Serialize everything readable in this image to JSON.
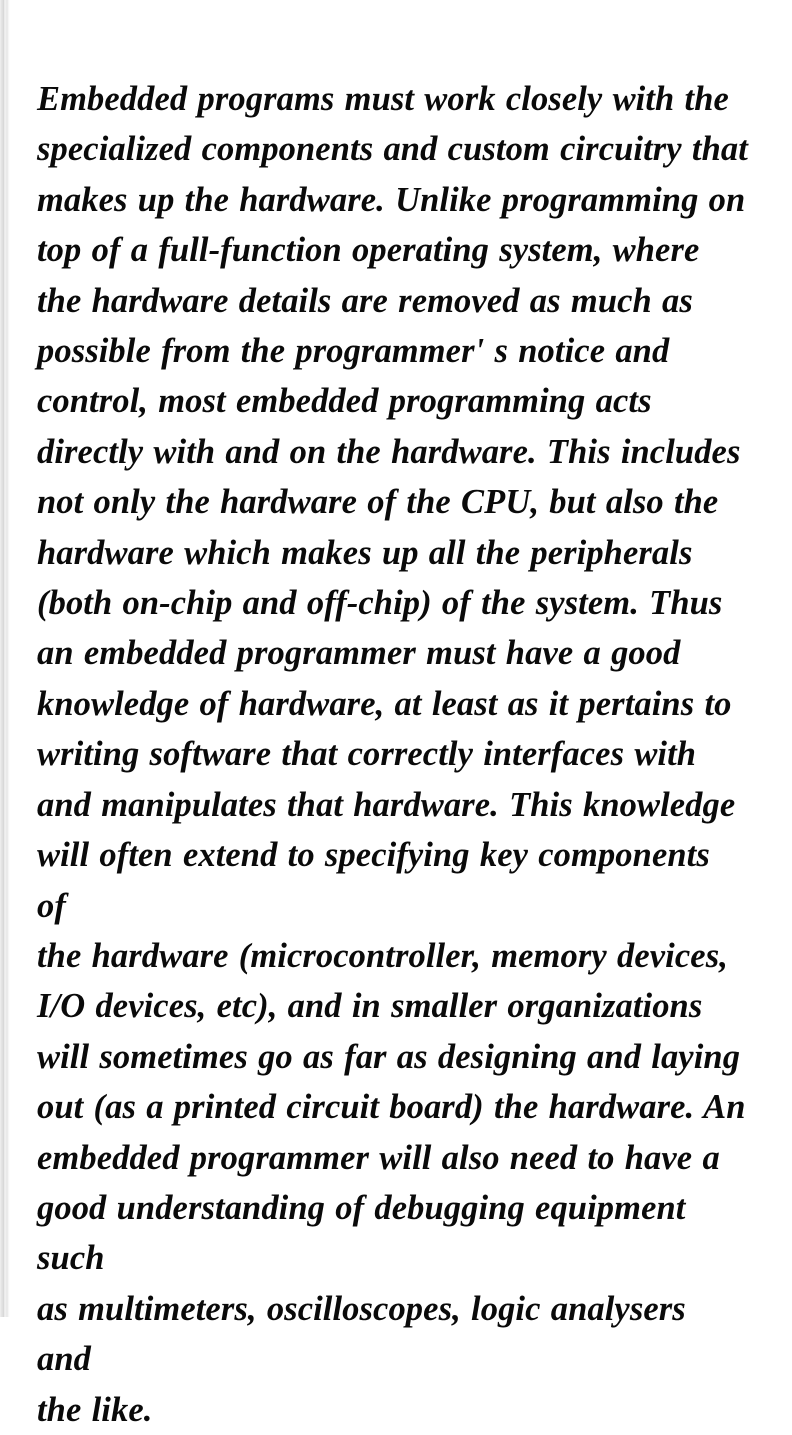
{
  "document": {
    "background_color": "#ffffff",
    "text_color": "#0a0a0a",
    "edge_shadow_color": "#d9d9d9",
    "paragraph": {
      "lines": [
        "Embedded programs must work closely with the",
        "specialized components and custom circuitry that",
        "makes up the hardware.  Unlike programming on",
        "top of a full-function operating system,  where",
        "the hardware details are removed as much as",
        "possible from the programmer' s notice and",
        "control,  most embedded programming acts",
        "directly with and on the hardware.  This includes",
        "not only the hardware of the CPU,  but also the",
        "hardware which makes up all the peripherals",
        "(both on-chip and off-chip) of the system.  Thus",
        "an embedded programmer must have a good",
        "knowledge of hardware,  at least as it pertains to",
        "writing software that correctly interfaces with",
        "and manipulates that hardware.  This knowledge",
        "will often extend to specifying key components of",
        "the hardware (microcontroller,  memory devices,",
        "I/O devices,  etc),  and in smaller organizations",
        "will sometimes go as far as designing and laying",
        "out (as a printed circuit board) the hardware.  An",
        "embedded programmer will also need to have a",
        "good understanding of debugging equipment such",
        "as multimeters,  oscilloscopes,  logic analysers and",
        "the like."
      ],
      "full_text": "Embedded programs must work closely with the\nspecialized components and custom circuitry that\nmakes up the hardware.  Unlike programming on\ntop of a full-function operating system,  where\nthe hardware details are removed as much as\npossible from the programmer' s notice and\ncontrol,  most embedded programming acts\ndirectly with and on the hardware.  This includes\nnot only the hardware of the CPU,  but also the\nhardware which makes up all the peripherals\n(both on-chip and off-chip) of the system.  Thus\nan embedded programmer must have a good\nknowledge of hardware,  at least as it pertains to\nwriting software that correctly interfaces with\nand manipulates that hardware.  This knowledge\nwill often extend to specifying key components of\nthe hardware (microcontroller,  memory devices,\nI/O devices,  etc),  and in smaller organizations\nwill sometimes go as far as designing and laying\nout (as a printed circuit board) the hardware.  An\nembedded programmer will also need to have a\ngood understanding of debugging equipment such\nas multimeters,  oscilloscopes,  logic analysers and\nthe like."
    }
  }
}
